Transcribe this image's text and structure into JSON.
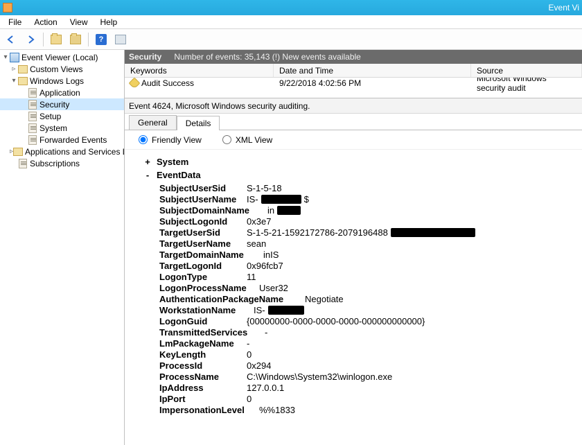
{
  "titlebar": {
    "title": "Event Vi"
  },
  "menu": {
    "file": "File",
    "action": "Action",
    "view": "View",
    "help": "Help"
  },
  "toolbar": {
    "help_glyph": "?"
  },
  "tree": {
    "root": "Event Viewer (Local)",
    "custom_views": "Custom Views",
    "windows_logs": "Windows Logs",
    "application": "Application",
    "security": "Security",
    "setup": "Setup",
    "system": "System",
    "forwarded": "Forwarded Events",
    "apps_services": "Applications and Services Lo",
    "subscriptions": "Subscriptions"
  },
  "secbar": {
    "title": "Security",
    "count": "Number of events: 35,143 (!) New events available"
  },
  "grid": {
    "headers": {
      "keywords": "Keywords",
      "datetime": "Date and Time",
      "source": "Source"
    },
    "rows": [
      {
        "keywords": "Audit Success",
        "datetime": "9/22/2018 4:02:56 PM",
        "source": "Microsoft Windows security audit"
      }
    ]
  },
  "event": {
    "title": "Event 4624, Microsoft Windows security auditing."
  },
  "tabs": {
    "general": "General",
    "details": "Details"
  },
  "radios": {
    "friendly": "Friendly View",
    "xml": "XML View"
  },
  "detail": {
    "system": "System",
    "eventdata": "EventData",
    "rows": {
      "SubjectUserSid": "S-1-5-18",
      "SubjectUserName_pre": "IS-",
      "SubjectUserName_post": "$",
      "SubjectDomainName_pre": "in",
      "SubjectLogonId": "0x3e7",
      "TargetUserSid_pre": "S-1-5-21-1592172786-2079196488",
      "TargetUserName": "sean",
      "TargetDomainName": "inIS",
      "TargetLogonId": "0x96fcb7",
      "LogonType": "11",
      "LogonProcessName": "User32",
      "AuthenticationPackageName": "Negotiate",
      "WorkstationName_pre": "IS-",
      "LogonGuid": "{00000000-0000-0000-0000-000000000000}",
      "TransmittedServices": "-",
      "LmPackageName": "-",
      "KeyLength": "0",
      "ProcessId": "0x294",
      "ProcessName": "C:\\Windows\\System32\\winlogon.exe",
      "IpAddress": "127.0.0.1",
      "IpPort": "0",
      "ImpersonationLevel": "%%1833"
    },
    "labels": {
      "SubjectUserSid": "SubjectUserSid",
      "SubjectUserName": "SubjectUserName",
      "SubjectDomainName": "SubjectDomainName",
      "SubjectLogonId": "SubjectLogonId",
      "TargetUserSid": "TargetUserSid",
      "TargetUserName": "TargetUserName",
      "TargetDomainName": "TargetDomainName",
      "TargetLogonId": "TargetLogonId",
      "LogonType": "LogonType",
      "LogonProcessName": "LogonProcessName",
      "AuthenticationPackageName": "AuthenticationPackageName",
      "WorkstationName": "WorkstationName",
      "LogonGuid": "LogonGuid",
      "TransmittedServices": "TransmittedServices",
      "LmPackageName": "LmPackageName",
      "KeyLength": "KeyLength",
      "ProcessId": "ProcessId",
      "ProcessName": "ProcessName",
      "IpAddress": "IpAddress",
      "IpPort": "IpPort",
      "ImpersonationLevel": "ImpersonationLevel"
    }
  }
}
